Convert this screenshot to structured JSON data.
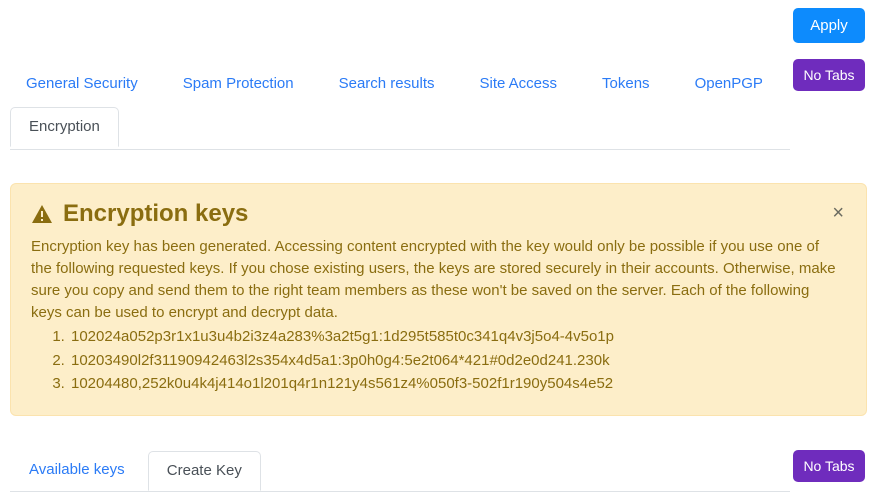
{
  "toolbar": {
    "apply_label": "Apply",
    "no_tabs_label": "No Tabs"
  },
  "nav": {
    "links": [
      {
        "label": "General Security"
      },
      {
        "label": "Spam Protection"
      },
      {
        "label": "Search results"
      },
      {
        "label": "Site Access"
      },
      {
        "label": "Tokens"
      },
      {
        "label": "OpenPGP"
      }
    ]
  },
  "top_tabs": {
    "items": [
      {
        "label": "Encryption",
        "active": true
      }
    ]
  },
  "alert": {
    "icon": "warning-triangle-icon",
    "title": "Encryption keys",
    "close_label": "×",
    "body": "Encryption key has been generated. Accessing content encrypted with the key would only be possible if you use one of the following requested keys. If you chose existing users, the keys are stored securely in their accounts. Otherwise, make sure you copy and send them to the right team members as these won't be saved on the server. Each of the following keys can be used to encrypt and decrypt data.",
    "keys": [
      "102024a052p3r1x1u3u4b2i3z4a283%3a2t5g1:1d295t585t0c341q4v3j5o4-4v5o1p",
      "10203490l2f31190942463l2s354x4d5a1:3p0h0g4:5e2t064*421#0d2e0d241.230k",
      "10204480,252k0u4k4j414o1l201q4r1n121y4s561z4%050f3-502f1r190y504s4e52"
    ],
    "colors": {
      "background": "#fdeec9",
      "border": "#fbe3ae",
      "text": "#8a6d10"
    }
  },
  "bottom_tabs": {
    "items": [
      {
        "label": "Available keys",
        "active": false
      },
      {
        "label": "Create Key",
        "active": true
      }
    ],
    "no_tabs_label": "No Tabs"
  },
  "colors": {
    "link": "#2b7bf6",
    "apply_button": "#0d8bfd",
    "no_tabs_button": "#6f2cbd"
  }
}
